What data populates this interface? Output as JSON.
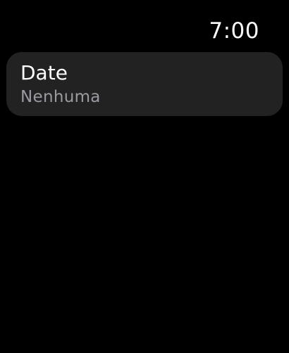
{
  "status_bar": {
    "time": "7:00"
  },
  "list": {
    "items": [
      {
        "title": "Date",
        "value": "Nenhuma"
      }
    ]
  },
  "colors": {
    "background": "#000000",
    "row_background": "#222222",
    "title_text": "#ffffff",
    "value_text": "#9a9aa4"
  }
}
